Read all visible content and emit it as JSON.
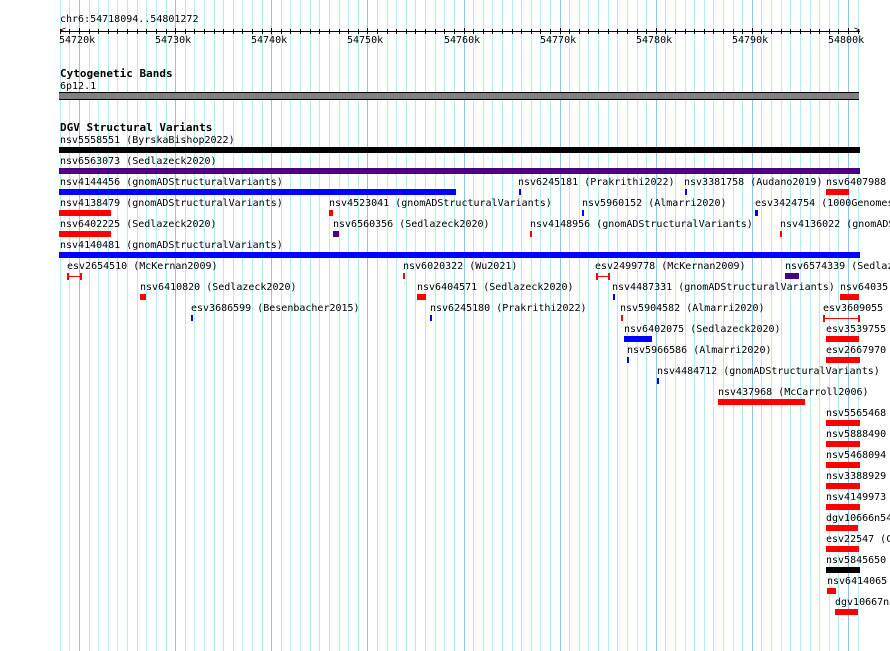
{
  "ruler": {
    "location": "chr6:54718094..54801272",
    "tick_labels": [
      "54720k",
      "54730k",
      "54740k",
      "54750k",
      "54760k",
      "54770k",
      "54780k",
      "54790k",
      "54800k"
    ]
  },
  "tracks": {
    "cytoband": {
      "title": "Cytogenetic Bands",
      "band": "6p12.1",
      "band_color": "#808080"
    },
    "dgv": {
      "title": "DGV Structural Variants",
      "features": [
        {
          "label": "nsv5558551 (ByrskaBishop2022)",
          "color": "#000000"
        },
        {
          "label": "nsv6563073 (Sedlazeck2020)",
          "color": "#4b0082"
        },
        {
          "label": "nsv4144456 (gnomADStructuralVariants)",
          "color": "#0000ff"
        },
        {
          "label": "nsv6245181 (Prakrithi2022)",
          "color": "#0000ff"
        },
        {
          "label": "nsv3381758 (Audano2019)",
          "color": "#0000ff"
        },
        {
          "label": "nsv6407988",
          "color": "#ff0000"
        },
        {
          "label": "nsv4138479 (gnomADStructuralVariants)",
          "color": "#ff0000"
        },
        {
          "label": "nsv4523041 (gnomADStructuralVariants)",
          "color": "#ff0000"
        },
        {
          "label": "nsv5960152 (Almarri2020)",
          "color": "#0000ff"
        },
        {
          "label": "esv3424754 (1000Genomes",
          "color": "#0000ff"
        },
        {
          "label": "nsv6402225 (Sedlazeck2020)",
          "color": "#ff0000"
        },
        {
          "label": "nsv6560356 (Sedlazeck2020)",
          "color": "#4b0082"
        },
        {
          "label": "nsv4148956 (gnomADStructuralVariants)",
          "color": "#ff0000"
        },
        {
          "label": "nsv4136022 (gnomADS",
          "color": "#ff0000"
        },
        {
          "label": "nsv4140481 (gnomADStructuralVariants)",
          "color": "#0000ff"
        },
        {
          "label": "esv2654510 (McKernan2009)",
          "color": "#ff0000"
        },
        {
          "label": "nsv6020322 (Wu2021)",
          "color": "#ff0000"
        },
        {
          "label": "esv2499778 (McKernan2009)",
          "color": "#ff0000"
        },
        {
          "label": "nsv6574339 (Sedlaz",
          "color": "#4b0082"
        },
        {
          "label": "nsv6410820 (Sedlazeck2020)",
          "color": "#ff0000"
        },
        {
          "label": "nsv6404571 (Sedlazeck2020)",
          "color": "#ff0000"
        },
        {
          "label": "nsv4487331 (gnomADStructuralVariants)",
          "color": "#0000ff"
        },
        {
          "label": "nsv64035",
          "color": "#ff0000"
        },
        {
          "label": "esv3686599 (Besenbacher2015)",
          "color": "#0000ff"
        },
        {
          "label": "nsv6245180 (Prakrithi2022)",
          "color": "#0000ff"
        },
        {
          "label": "nsv5904582 (Almarri2020)",
          "color": "#ff0000"
        },
        {
          "label": "esv3609055",
          "color": "#ff0000"
        },
        {
          "label": "nsv6402075 (Sedlazeck2020)",
          "color": "#0000ff"
        },
        {
          "label": "esv3539755",
          "color": "#ff0000"
        },
        {
          "label": "nsv5966586 (Almarri2020)",
          "color": "#0000ff"
        },
        {
          "label": "esv2667970",
          "color": "#ff0000"
        },
        {
          "label": "nsv4484712 (gnomADStructuralVariants)",
          "color": "#0000ff"
        },
        {
          "label": "nsv437968 (McCarroll2006)",
          "color": "#ff0000"
        },
        {
          "label": "nsv5565468",
          "color": "#ff0000"
        },
        {
          "label": "nsv5888490",
          "color": "#ff0000"
        },
        {
          "label": "nsv5468094",
          "color": "#ff0000"
        },
        {
          "label": "nsv3388929",
          "color": "#ff0000"
        },
        {
          "label": "nsv4149973",
          "color": "#ff0000"
        },
        {
          "label": "dgv10666n54",
          "color": "#ff0000"
        },
        {
          "label": "esv22547 (C",
          "color": "#ff0000"
        },
        {
          "label": "nsv5845650",
          "color": "#000000"
        },
        {
          "label": "nsv6414065",
          "color": "#ff0000"
        },
        {
          "label": "dgv10667n5",
          "color": "#ff0000"
        }
      ]
    }
  }
}
